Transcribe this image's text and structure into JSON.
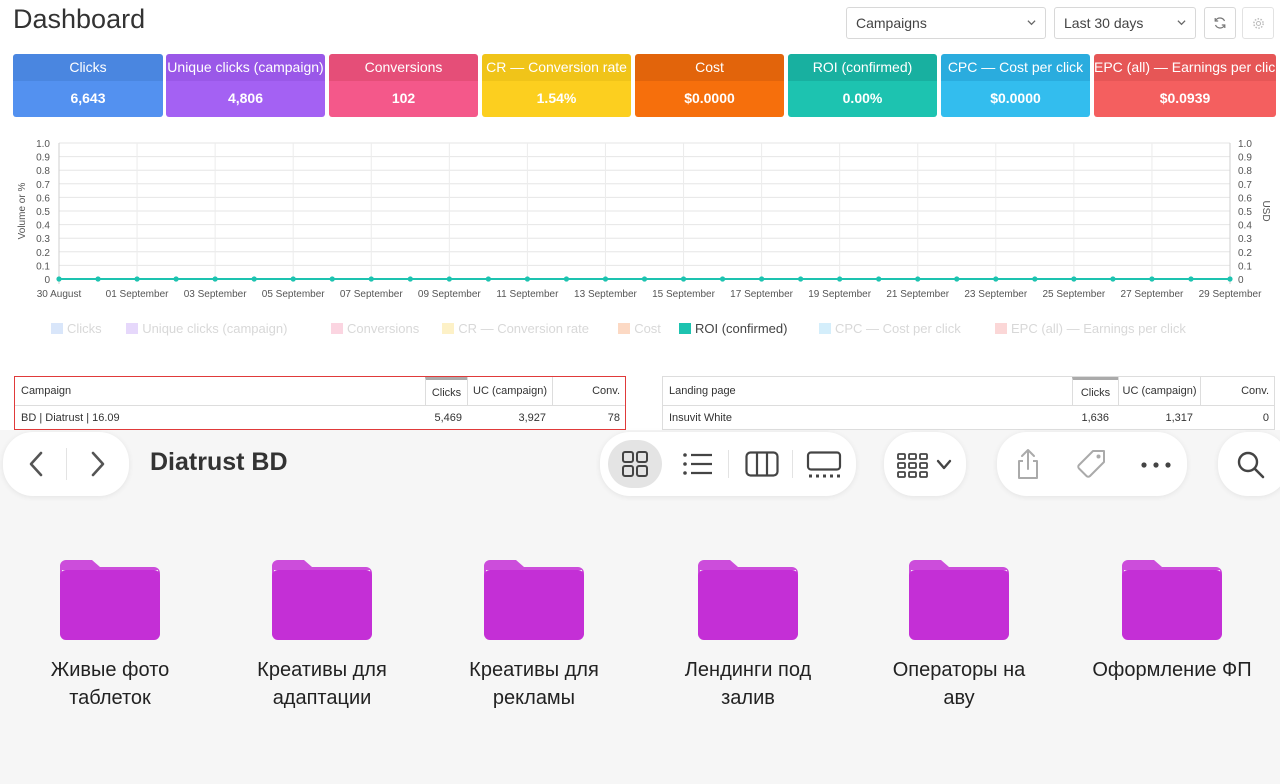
{
  "header": {
    "title": "Dashboard",
    "entity_select": "Campaigns",
    "period_select": "Last 30 days",
    "refresh_icon": "refresh-icon",
    "settings_icon": "gear-icon"
  },
  "stats": [
    {
      "label": "Clicks",
      "value": "6,643",
      "top": "#4a86e0",
      "bottom": "#5391f0"
    },
    {
      "label": "Unique clicks (campaign)",
      "value": "4,806",
      "top": "#9a58e8",
      "bottom": "#a461f3"
    },
    {
      "label": "Conversions",
      "value": "102",
      "top": "#e54e78",
      "bottom": "#f4588a"
    },
    {
      "label": "CR — Conversion rate",
      "value": "1.54%",
      "top": "#f0c419",
      "bottom": "#fccf1f"
    },
    {
      "label": "Cost",
      "value": "$0.0000",
      "top": "#e2640b",
      "bottom": "#f66f0c"
    },
    {
      "label": "ROI (confirmed)",
      "value": "0.00%",
      "top": "#18b0a0",
      "bottom": "#1dc3b0"
    },
    {
      "label": "CPC — Cost per click",
      "value": "$0.0000",
      "top": "#2aacde",
      "bottom": "#33bdee"
    },
    {
      "label": "EPC (all) — Earnings per click",
      "value": "$0.0939",
      "top": "#e65656",
      "bottom": "#f45f5f"
    }
  ],
  "chart_data": {
    "type": "line",
    "x": [
      "30 August",
      "31 August",
      "01 September",
      "02 September",
      "03 September",
      "04 September",
      "05 September",
      "06 September",
      "07 September",
      "08 September",
      "09 September",
      "10 September",
      "11 September",
      "12 September",
      "13 September",
      "14 September",
      "15 September",
      "16 September",
      "17 September",
      "18 September",
      "19 September",
      "20 September",
      "21 September",
      "22 September",
      "23 September",
      "24 September",
      "25 September",
      "26 September",
      "27 September",
      "28 September",
      "29 September"
    ],
    "xtick_labels": [
      "30 August",
      "01 September",
      "03 September",
      "05 September",
      "07 September",
      "09 September",
      "11 September",
      "13 September",
      "15 September",
      "17 September",
      "19 September",
      "21 September",
      "23 September",
      "25 September",
      "27 September",
      "29 September"
    ],
    "ylabel_left": "Volume or %",
    "ylabel_right": "USD",
    "ylim": [
      0,
      1
    ],
    "yticks": [
      "0",
      "0.1",
      "0.2",
      "0.3",
      "0.4",
      "0.5",
      "0.6",
      "0.7",
      "0.8",
      "0.9",
      "1.0"
    ],
    "grid": true,
    "legend_position": "bottom",
    "series": [
      {
        "name": "Clicks",
        "color": "#d9e6fa",
        "visible": false,
        "values": []
      },
      {
        "name": "Unique clicks (campaign)",
        "color": "#e6d8fb",
        "visible": false,
        "values": []
      },
      {
        "name": "Conversions",
        "color": "#fbd5e1",
        "visible": false,
        "values": []
      },
      {
        "name": "CR — Conversion rate",
        "color": "#fdf1c7",
        "visible": false,
        "values": []
      },
      {
        "name": "Cost",
        "color": "#fcd9c4",
        "visible": false,
        "values": []
      },
      {
        "name": "ROI (confirmed)",
        "color": "#1dc3b0",
        "visible": true,
        "values": [
          0,
          0,
          0,
          0,
          0,
          0,
          0,
          0,
          0,
          0,
          0,
          0,
          0,
          0,
          0,
          0,
          0,
          0,
          0,
          0,
          0,
          0,
          0,
          0,
          0,
          0,
          0,
          0,
          0,
          0,
          0
        ]
      },
      {
        "name": "CPC — Cost per click",
        "color": "#d4eefb",
        "visible": false,
        "values": []
      },
      {
        "name": "EPC (all) — Earnings per click",
        "color": "#fbd7d7",
        "visible": false,
        "values": []
      }
    ]
  },
  "campaign_table": {
    "headers": [
      "Campaign",
      "Clicks",
      "UC (campaign)",
      "Conv."
    ],
    "rows": [
      [
        "BD | Diatrust | 16.09",
        "5,469",
        "3,927",
        "78"
      ]
    ]
  },
  "landing_table": {
    "headers": [
      "Landing page",
      "Clicks",
      "UC (campaign)",
      "Conv."
    ],
    "rows": [
      [
        "Insuvit White",
        "1,636",
        "1,317",
        "0"
      ]
    ]
  },
  "finder": {
    "title": "Diatrust BD",
    "folder_color": "#c42fd6",
    "folders": [
      {
        "name": "Живые фото\nтаблеток"
      },
      {
        "name": "Креативы для\nадаптации"
      },
      {
        "name": "Креативы для\nрекламы"
      },
      {
        "name": "Лендинги под\nзалив"
      },
      {
        "name": "Операторы на\nаву"
      },
      {
        "name": "Оформление ФП"
      }
    ]
  }
}
